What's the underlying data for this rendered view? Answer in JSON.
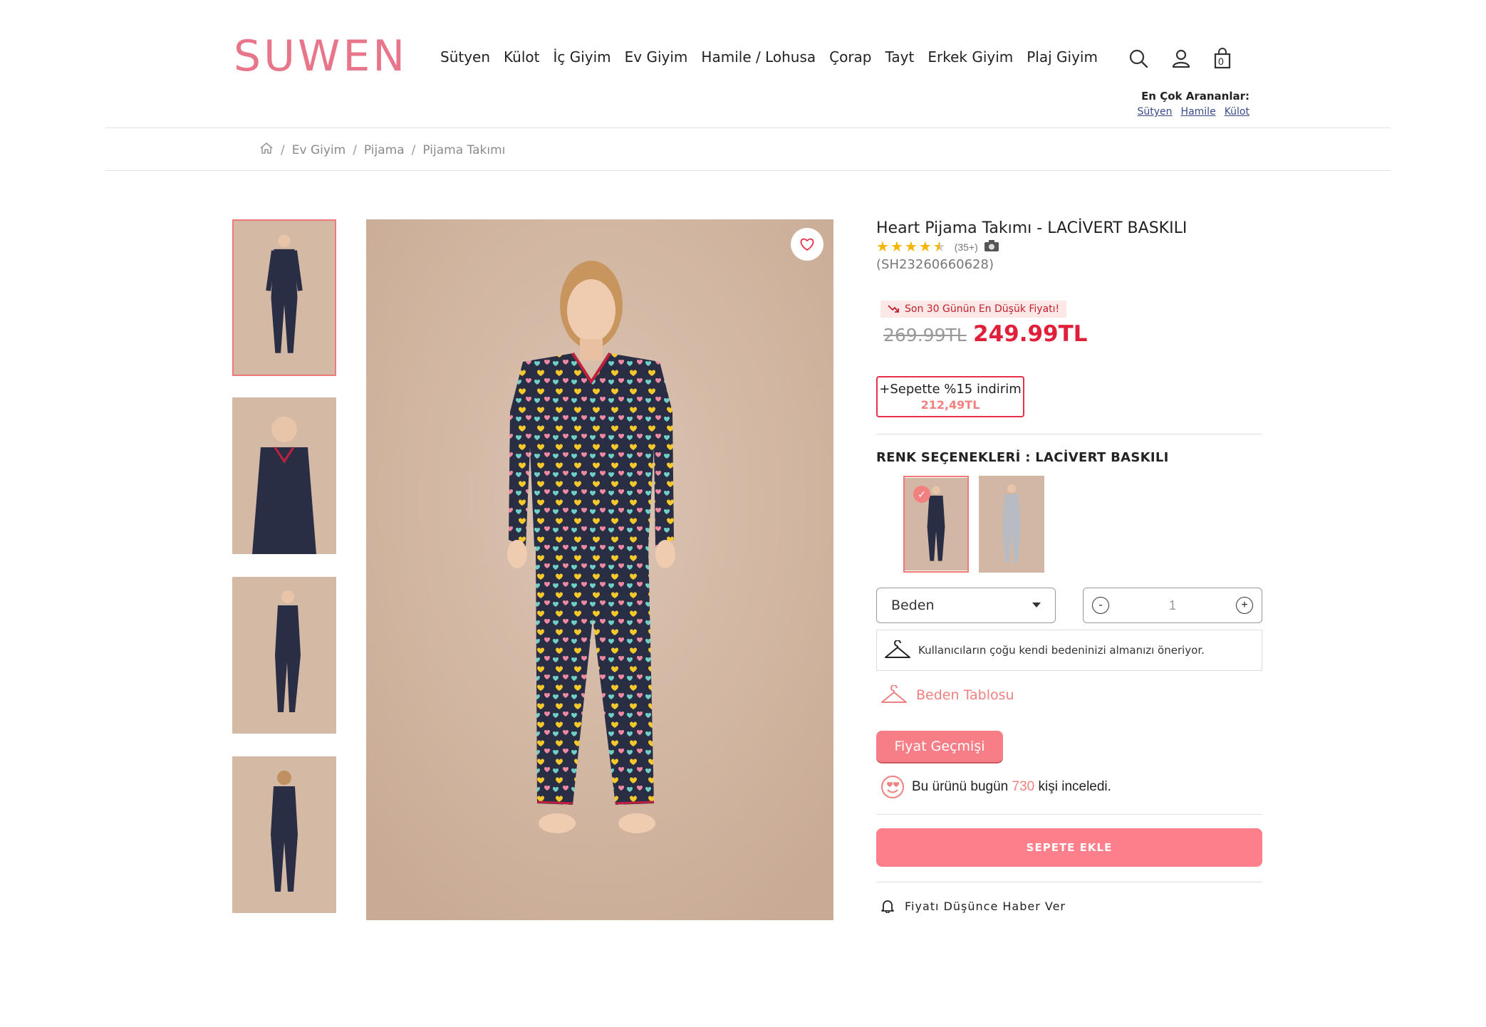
{
  "header": {
    "logo_text": "SUWEN",
    "nav": [
      "Sütyen",
      "Külot",
      "İç Giyim",
      "Ev Giyim",
      "Hamile / Lohusa",
      "Çorap",
      "Tayt",
      "Erkek Giyim",
      "Plaj Giyim"
    ],
    "cart_count": "0",
    "top_searches_label": "En Çok Arananlar:",
    "top_searches": [
      "Sütyen",
      "Hamile",
      "Külot"
    ]
  },
  "breadcrumb": [
    "Ev Giyim",
    "Pijama",
    "Pijama Takımı"
  ],
  "product": {
    "title": "Heart Pijama Takımı - LACİVERT BASKILI",
    "rating": 4.5,
    "review_count": "(35+)",
    "sku": "(SH23260660628)",
    "lowest_price_badge": "Son 30 Günün En Düşük Fiyatı!",
    "old_price": "269.99TL",
    "price": "249.99TL",
    "basket_discount_label": "+Sepette %15 indirim",
    "basket_price": "212,49TL",
    "color_label": "RENK SEÇENEKLERİ : LACİVERT BASKILI",
    "size_placeholder": "Beden",
    "quantity": "1",
    "size_advice": "Kullanıcıların çoğu kendi bedeninizi almanızı öneriyor.",
    "size_table": "Beden Tablosu",
    "price_history": "Fiyat Geçmişi",
    "viewed_prefix": "Bu ürünü bugün",
    "viewed_count": "730",
    "viewed_suffix": "kişi inceledi.",
    "add_to_cart": "SEPETE EKLE",
    "notify_price": "Fiyatı Düşünce Haber Ver"
  },
  "colors": {
    "brand": "#e8768b",
    "accent": "#fd7f8c",
    "price_red": "#e0203a",
    "photo_bg": "#d1b7a2",
    "pajama_navy": "#2a2e45"
  }
}
